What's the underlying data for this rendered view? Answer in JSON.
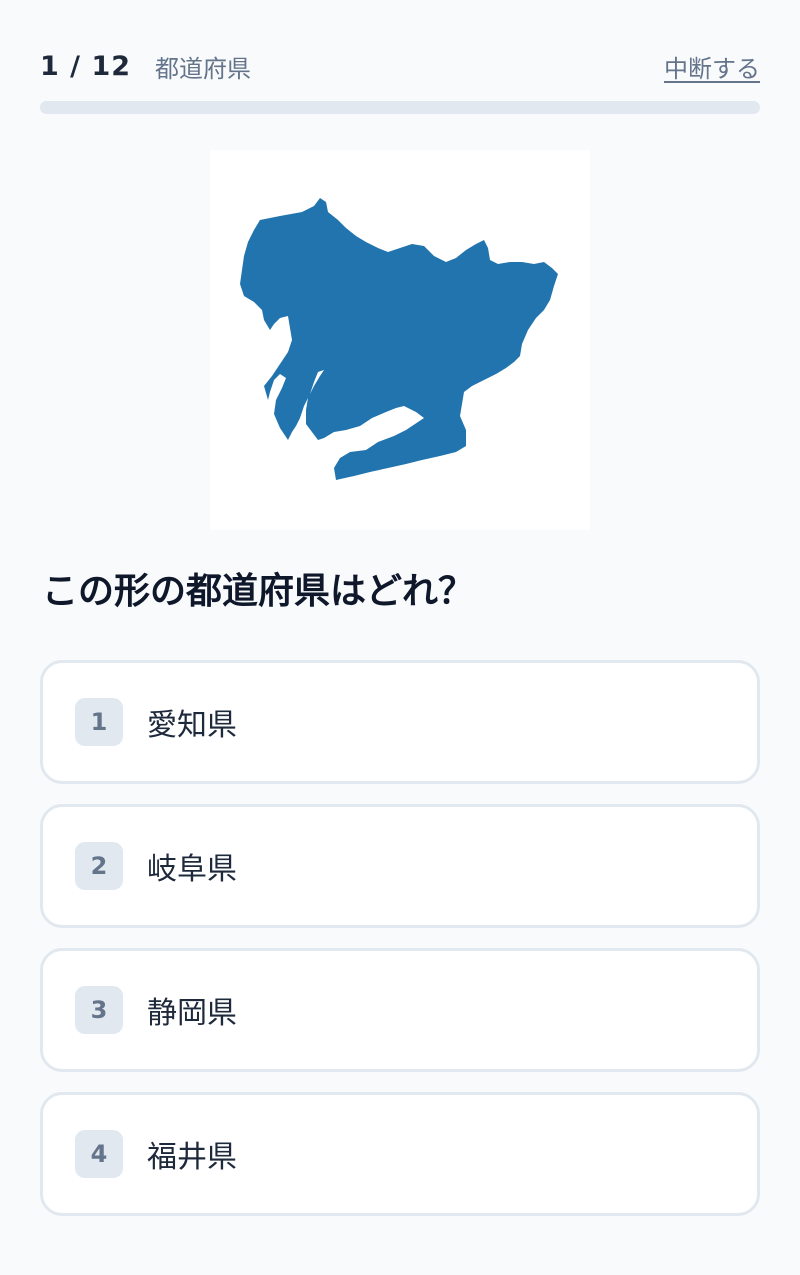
{
  "header": {
    "counter": "1 / 12",
    "category": "都道府県",
    "quit_label": "中断する"
  },
  "progress": {
    "current": 1,
    "total": 12,
    "fraction": 0.0833
  },
  "map": {
    "icon": "aichi-prefecture-map-icon",
    "fill_color": "#2174ad"
  },
  "question": {
    "text": "この形の都道府県はどれ？"
  },
  "options": [
    {
      "number": "1",
      "label": "愛知県"
    },
    {
      "number": "2",
      "label": "岐阜県"
    },
    {
      "number": "3",
      "label": "静岡県"
    },
    {
      "number": "4",
      "label": "福井県"
    }
  ],
  "colors": {
    "background": "#f8fafc",
    "border": "#e2e8f0",
    "muted_text": "#64748b",
    "map_blue": "#2174ad"
  }
}
